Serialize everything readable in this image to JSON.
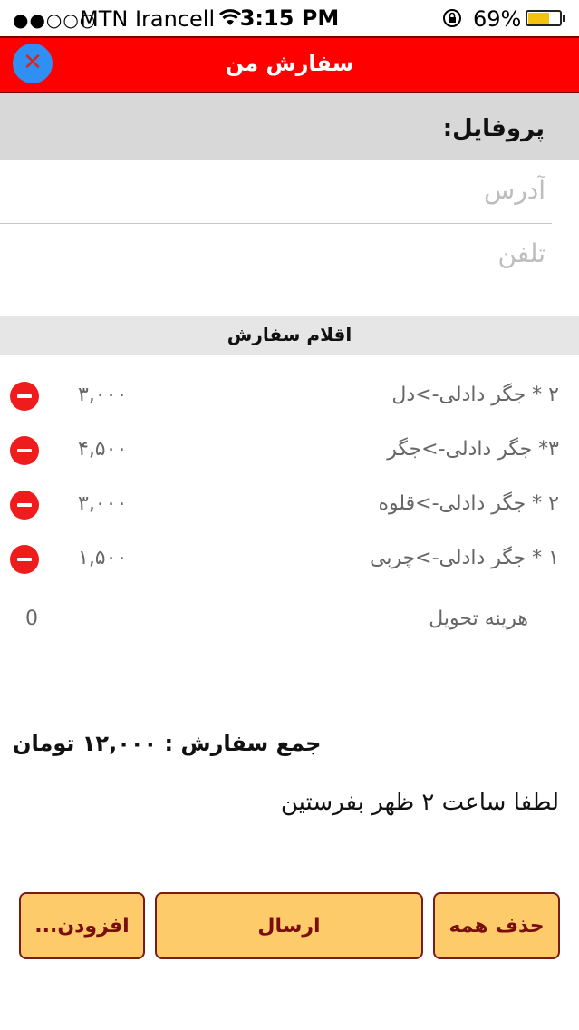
{
  "status_bar": {
    "signal": "●●○○○",
    "carrier": "MTN Irancell",
    "time": "3:15 PM",
    "battery_pct": "69%",
    "battery_level": 0.69,
    "icons": [
      "wifi-icon",
      "rotation-lock-icon",
      "battery-icon"
    ]
  },
  "header": {
    "title": "سفارش من",
    "close_icon": "close-icon"
  },
  "profile": {
    "label": "پروفایل:",
    "address_placeholder": "آدرس",
    "phone_placeholder": "تلفن"
  },
  "items_section": {
    "label": "اقلام سفارش"
  },
  "items": [
    {
      "name": "۲ * جگر دادلی->دل",
      "price": "۳,۰۰۰"
    },
    {
      "name": "۳* جگر دادلی->جگر",
      "price": "۴,۵۰۰"
    },
    {
      "name": "۲ * جگر دادلی->قلوه",
      "price": "۳,۰۰۰"
    },
    {
      "name": "۱ * جگر دادلی->چربی",
      "price": "۱,۵۰۰"
    }
  ],
  "delivery": {
    "label": "هرینه تحویل",
    "value": "0"
  },
  "summary": {
    "total": "جمع سفارش : ۱۲,۰۰۰ تومان",
    "note": "لطفا ساعت ۲ ظهر بفرستین"
  },
  "buttons": {
    "more": "افزودن...",
    "send": "ارسال",
    "clear_all": "حذف همه"
  },
  "colors": {
    "header": "#ff0000",
    "close_button": "#2f8ff2",
    "remove_button": "#ee1c1c",
    "action_button": "#fecb6b",
    "action_text": "#7a0e0e"
  }
}
